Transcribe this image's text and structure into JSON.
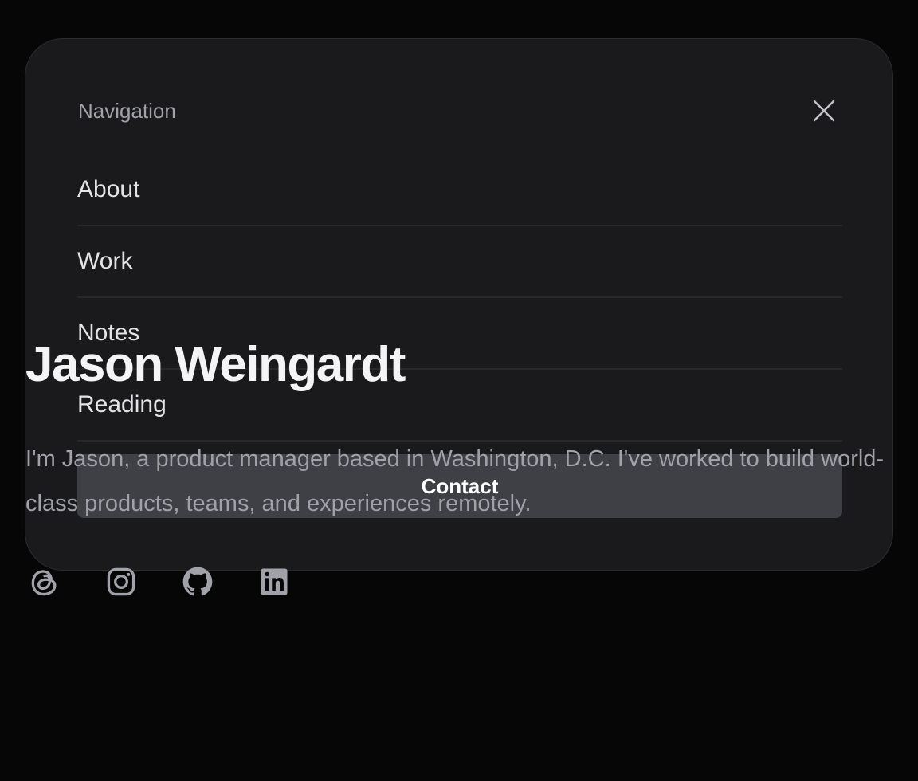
{
  "profile": {
    "name": "Jason Weingardt",
    "bio": "I'm Jason, a product manager based in Washington, D.C. I've worked to build world-class products, teams, and experiences remotely."
  },
  "socials": [
    {
      "icon": "threads-icon"
    },
    {
      "icon": "instagram-icon"
    },
    {
      "icon": "github-icon"
    },
    {
      "icon": "linkedin-icon"
    }
  ],
  "navigation": {
    "title": "Navigation",
    "close_icon": "close-icon",
    "items": [
      {
        "label": "About"
      },
      {
        "label": "Work"
      },
      {
        "label": "Notes"
      },
      {
        "label": "Reading"
      }
    ],
    "contact_label": "Contact"
  },
  "colors": {
    "background": "#060606",
    "panel": "#1a1a1c",
    "contact_button": "#3f3f46",
    "muted_text": "#a1a1aa"
  }
}
